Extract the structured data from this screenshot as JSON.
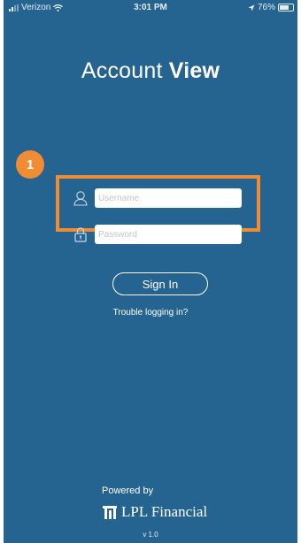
{
  "status_bar": {
    "carrier": "Verizon",
    "time": "3:01 PM",
    "battery": "76%"
  },
  "app": {
    "title_light": "Account ",
    "title_bold": "View"
  },
  "annotation": {
    "step_number": "1",
    "accent_color": "#f08c33"
  },
  "login_form": {
    "username_placeholder": "Username",
    "password_placeholder": "Password",
    "sign_in_label": "Sign In",
    "trouble_link": "Trouble logging in?"
  },
  "footer": {
    "powered_by": "Powered by",
    "brand": "LPL Financial",
    "version": "v 1.0"
  },
  "colors": {
    "background": "#256491"
  }
}
